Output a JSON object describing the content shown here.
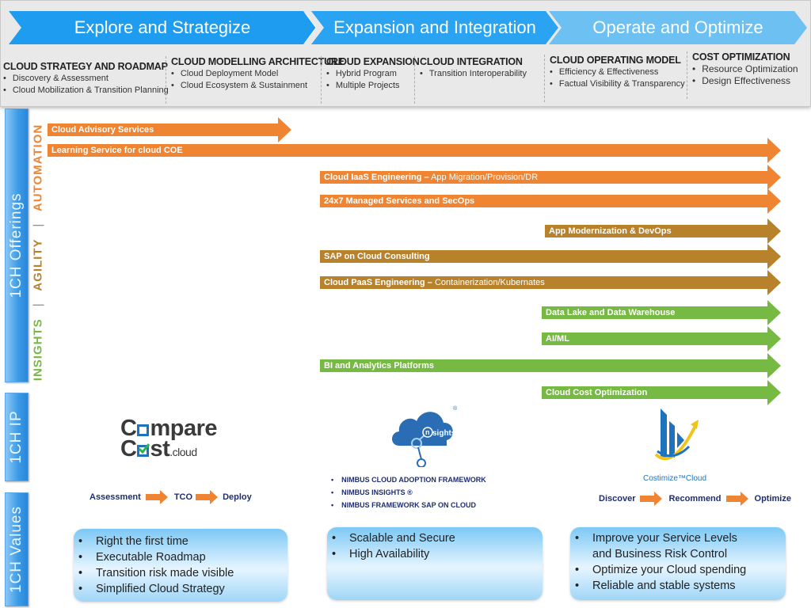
{
  "phases": [
    {
      "title": "Explore and Strategize",
      "color": "#1e9cf0"
    },
    {
      "title": "Expansion and Integration",
      "color": "#2aa3f2"
    },
    {
      "title": "Operate and Optimize",
      "color": "#6cc0f2"
    }
  ],
  "phase_columns": [
    {
      "heading": "CLOUD STRATEGY AND ROADMAP",
      "items": [
        "Discovery & Assessment",
        "Cloud Mobilization & Transition Planning"
      ]
    },
    {
      "heading": "CLOUD MODELLING ARCHITECTURE",
      "items": [
        "Cloud Deployment Model",
        "Cloud Ecosystem & Sustainment"
      ]
    },
    {
      "heading": "CLOUD EXPANSION",
      "items": [
        "Hybrid Program",
        "Multiple Projects"
      ]
    },
    {
      "heading": "CLOUD INTEGRATION",
      "items": [
        "Transition Interoperability"
      ]
    },
    {
      "heading": "CLOUD OPERATING MODEL",
      "items": [
        "Efficiency & Effectiveness",
        "Factual Visibility & Transparency"
      ]
    },
    {
      "heading": "COST OPTIMIZATION",
      "items": [
        "Resource Optimization",
        "Design Effectiveness"
      ]
    }
  ],
  "side_tabs": {
    "offerings": "1CH Offerings",
    "ip": "1CH IP",
    "values": "1CH Values"
  },
  "themes": {
    "insights": {
      "label": "INSIGHTS",
      "color": "#76b943"
    },
    "separator": "|",
    "agility": {
      "label": "AGILITY",
      "color": "#b8822c"
    },
    "automation": {
      "label": "AUTOMATION",
      "color": "#ef8433"
    }
  },
  "offerings": [
    {
      "label": "Cloud Advisory Services",
      "sub": "",
      "theme": "automation"
    },
    {
      "label": "Learning Service for cloud COE",
      "sub": "",
      "theme": "automation"
    },
    {
      "label": "Cloud IaaS Engineering –",
      "sub": " App Migration/Provision/DR",
      "theme": "automation"
    },
    {
      "label": "24x7 Managed Services and SecOps",
      "sub": "",
      "theme": "automation"
    },
    {
      "label": "App Modernization & DevOps",
      "sub": "",
      "theme": "agility"
    },
    {
      "label": "SAP on Cloud Consulting",
      "sub": "",
      "theme": "agility"
    },
    {
      "label": "Cloud PaaS Engineering –",
      "sub": " Containerization/Kubernates",
      "theme": "agility"
    },
    {
      "label": "Data Lake and Data Warehouse",
      "sub": "",
      "theme": "insights"
    },
    {
      "label": "AI/ML",
      "sub": "",
      "theme": "insights"
    },
    {
      "label": "BI and Analytics Platforms",
      "sub": "",
      "theme": "insights"
    },
    {
      "label": "Cloud Cost Optimization",
      "sub": "",
      "theme": "insights"
    }
  ],
  "ip": {
    "comparecost": {
      "line1a": "C",
      "line1b": "mpare",
      "line2a": "C",
      "line2b": "st",
      "line2c": ".cloud",
      "flow": [
        "Assessment",
        "TCO",
        "Deploy"
      ]
    },
    "nimbus": {
      "logo_text": "sights",
      "logo_n": "n",
      "reg": "®",
      "items": [
        "NIMBUS CLOUD ADOPTION FRAMEWORK",
        "NIMBUS INSIGHTS ®",
        "NIMBUS FRAMEWORK SAP ON CLOUD"
      ]
    },
    "costimize": {
      "logo_text": "Costimize™Cloud",
      "flow": [
        "Discover",
        "Recommend",
        "Optimize"
      ]
    }
  },
  "values": [
    [
      "Right the first time",
      "Executable Roadmap",
      "Transition risk made visible",
      "Simplified Cloud Strategy"
    ],
    [
      "Scalable and Secure",
      "High Availability"
    ],
    [
      "Improve your Service Levels and Business Risk Control",
      "Optimize your Cloud spending",
      "Reliable and stable systems"
    ]
  ],
  "colors": {
    "arrow_orange": "#ef8433",
    "flow_navy": "#1f2e6e",
    "tab_blue": "#3d9ce8"
  }
}
